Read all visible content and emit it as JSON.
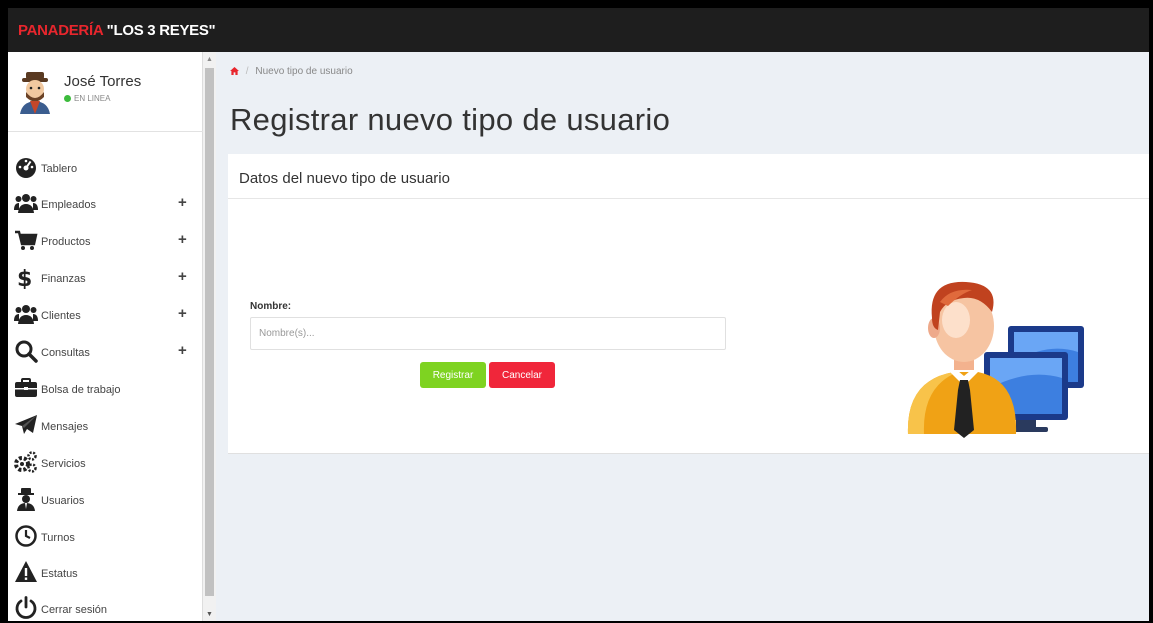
{
  "app": {
    "brand_part1": "PANADERÍA",
    "brand_part2": " \"LOS 3 REYES\""
  },
  "user": {
    "name": "José Torres",
    "status": "EN LINEA"
  },
  "sidebar": {
    "items": [
      {
        "label": "Tablero",
        "icon": "dashboard-icon",
        "expandable": false
      },
      {
        "label": "Empleados",
        "icon": "users-icon",
        "expandable": true,
        "plus": "+"
      },
      {
        "label": "Productos",
        "icon": "cart-icon",
        "expandable": true,
        "plus": "+"
      },
      {
        "label": "Finanzas",
        "icon": "dollar-icon",
        "expandable": true,
        "plus": "+"
      },
      {
        "label": "Clientes",
        "icon": "users-icon",
        "expandable": true,
        "plus": "+"
      },
      {
        "label": "Consultas",
        "icon": "search-icon",
        "expandable": true,
        "plus": "+"
      },
      {
        "label": "Bolsa de trabajo",
        "icon": "briefcase-icon",
        "expandable": false
      },
      {
        "label": "Mensajes",
        "icon": "paper-plane-icon",
        "expandable": false
      },
      {
        "label": "Servicios",
        "icon": "cogs-icon",
        "expandable": false
      },
      {
        "label": "Usuarios",
        "icon": "user-secret-icon",
        "expandable": false
      },
      {
        "label": "Turnos",
        "icon": "clock-icon",
        "expandable": false
      },
      {
        "label": "Estatus",
        "icon": "warning-icon",
        "expandable": false
      },
      {
        "label": "Cerrar sesión",
        "icon": "power-icon",
        "expandable": false
      }
    ]
  },
  "breadcrumb": {
    "current": "Nuevo tipo de usuario"
  },
  "page": {
    "title": "Registrar nuevo tipo de usuario"
  },
  "form": {
    "heading": "Datos del nuevo tipo de usuario",
    "name_label": "Nombre:",
    "name_value": "",
    "name_placeholder": "Nombre(s)...",
    "register_label": "Registrar",
    "cancel_label": "Cancelar"
  },
  "colors": {
    "brand_red": "#e8262d",
    "register_green": "#7ed321",
    "cancel_red": "#f0263a",
    "topbar": "#1e1e1e",
    "status_green": "#3cbb3c"
  }
}
